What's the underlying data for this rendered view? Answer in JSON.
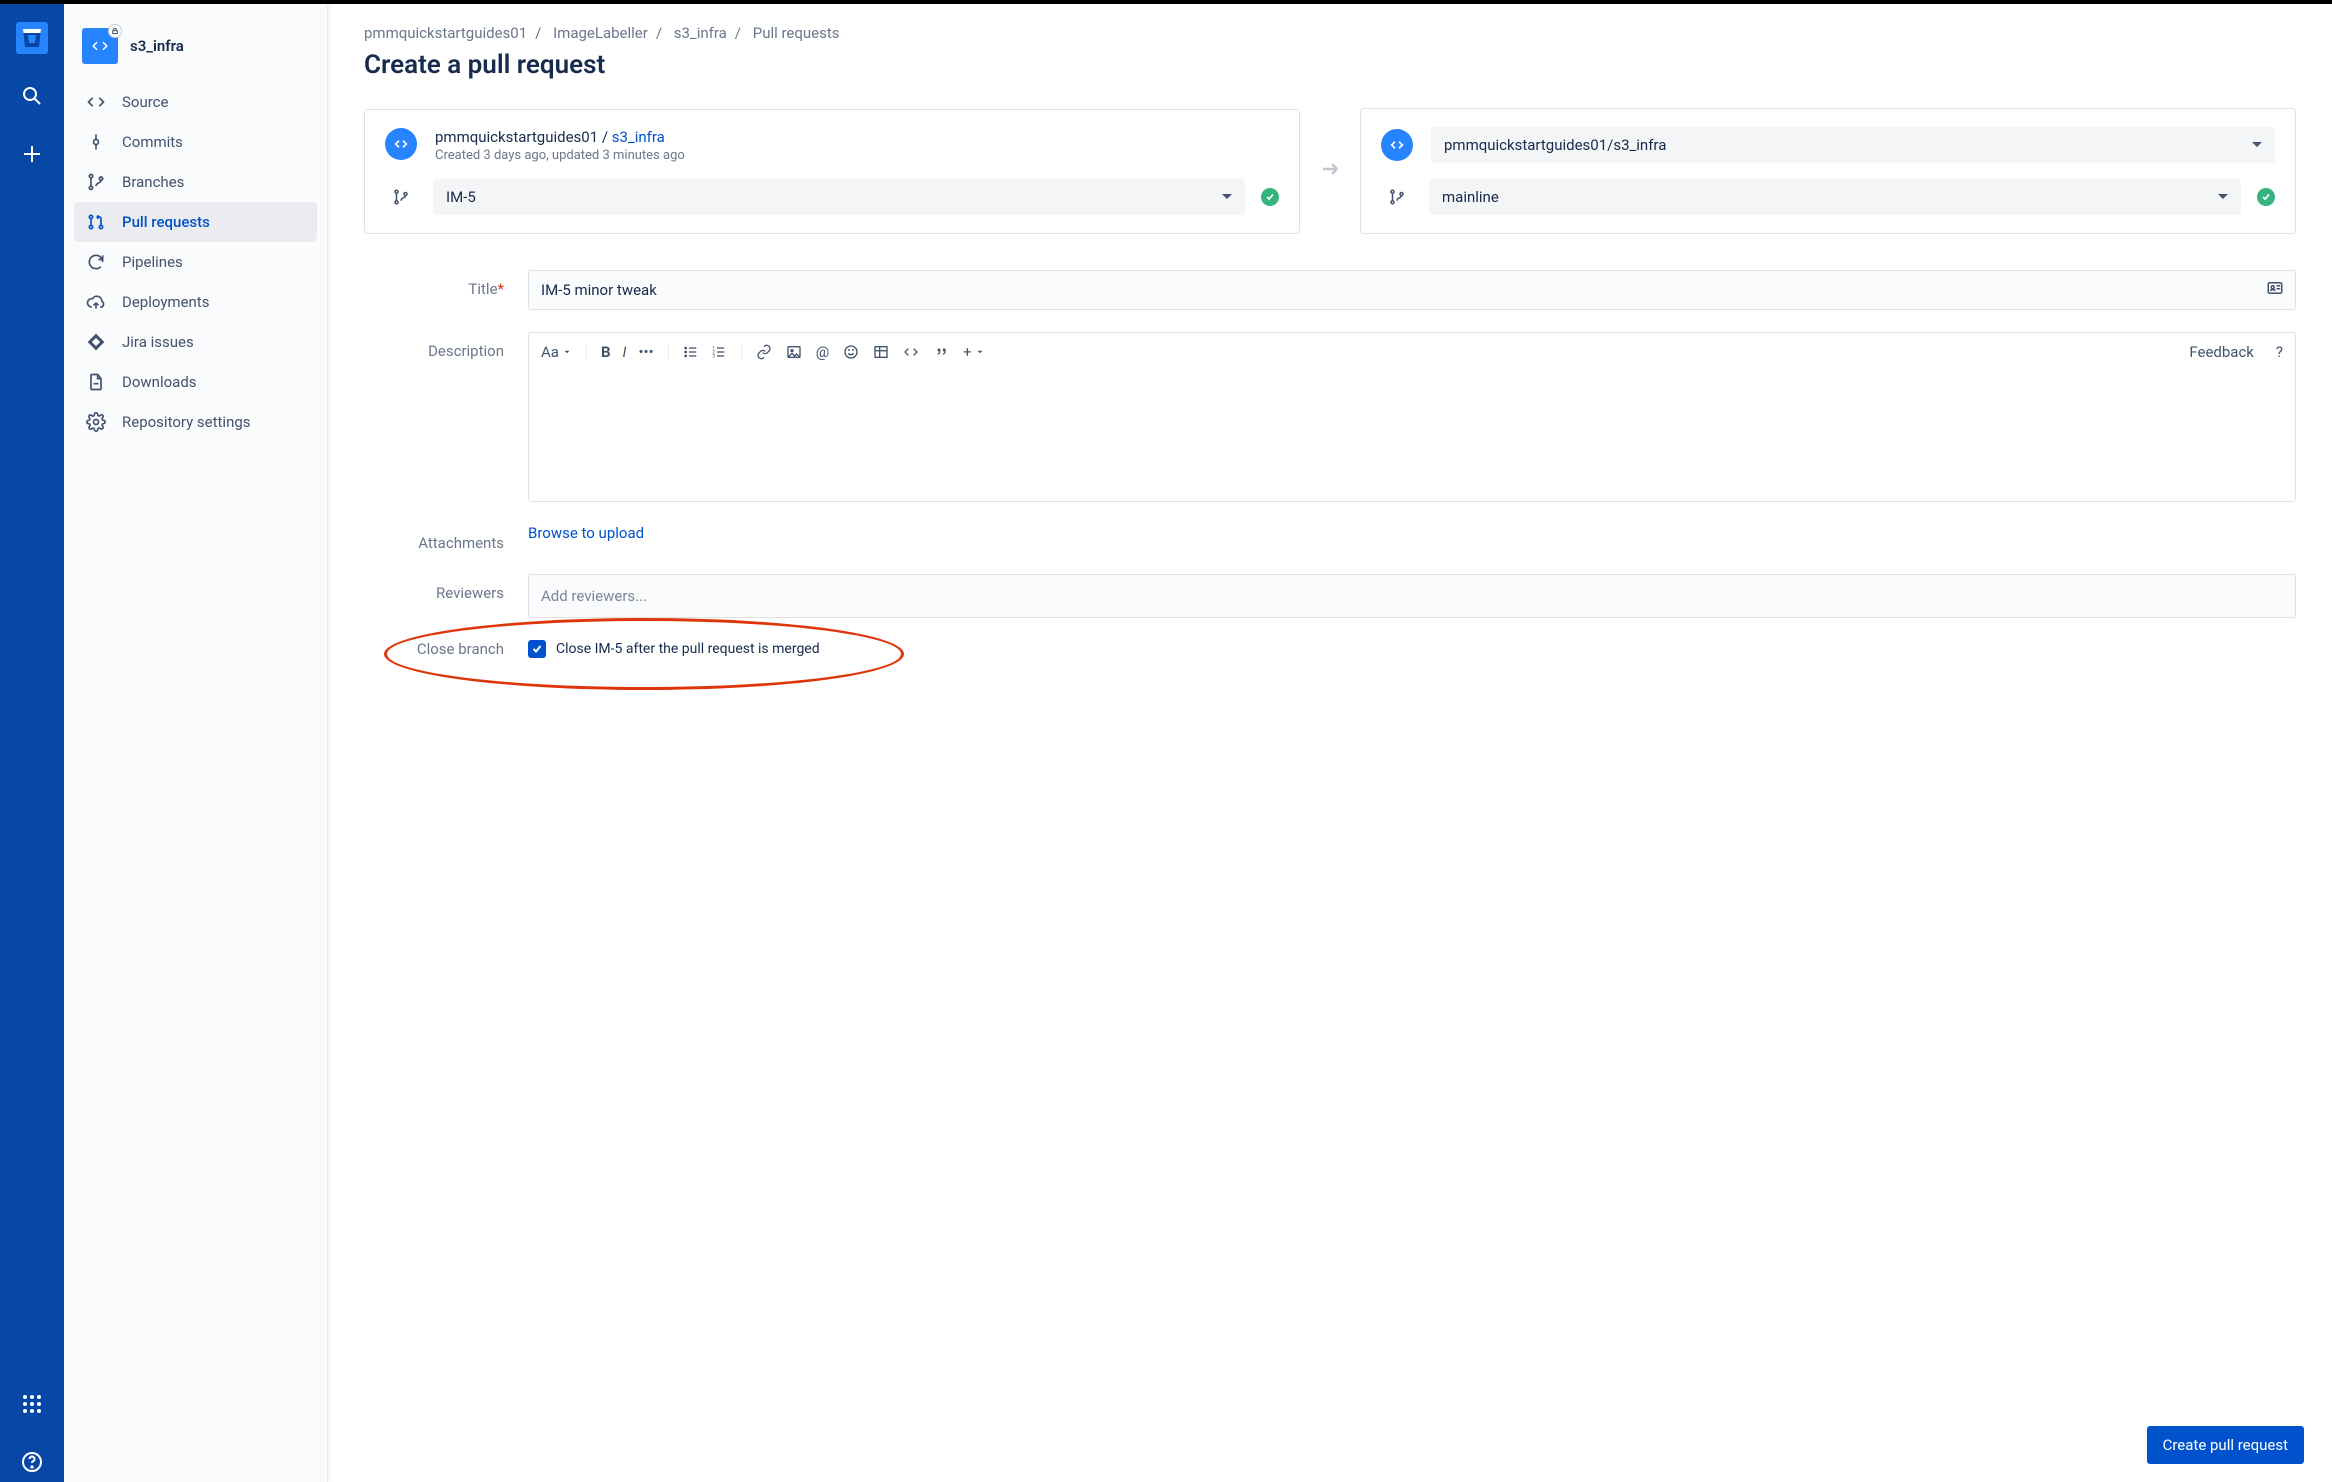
{
  "repo": {
    "name": "s3_infra"
  },
  "nav": {
    "items": [
      {
        "label": "Source"
      },
      {
        "label": "Commits"
      },
      {
        "label": "Branches"
      },
      {
        "label": "Pull requests"
      },
      {
        "label": "Pipelines"
      },
      {
        "label": "Deployments"
      },
      {
        "label": "Jira issues"
      },
      {
        "label": "Downloads"
      },
      {
        "label": "Repository settings"
      }
    ]
  },
  "crumbs": {
    "a": "pmmquickstartguides01",
    "b": "ImageLabeller",
    "c": "s3_infra",
    "d": "Pull requests"
  },
  "page_title": "Create a pull request",
  "source_card": {
    "workspace": "pmmquickstartguides01 / ",
    "repo": "s3_infra",
    "meta": "Created 3 days ago, updated 3 minutes ago",
    "branch": "IM-5"
  },
  "dest_card": {
    "path": "pmmquickstartguides01/s3_infra",
    "branch": "mainline"
  },
  "form": {
    "title_label": "Title",
    "title_value": "IM-5 minor tweak",
    "desc_label": "Description",
    "styles_btn": "Aa",
    "feedback": "Feedback",
    "attach_label": "Attachments",
    "attach_link": "Browse to upload",
    "reviewers_label": "Reviewers",
    "reviewers_placeholder": "Add reviewers...",
    "close_label": "Close branch",
    "close_text": "Close IM-5 after the pull request is merged"
  },
  "submit": "Create pull request"
}
